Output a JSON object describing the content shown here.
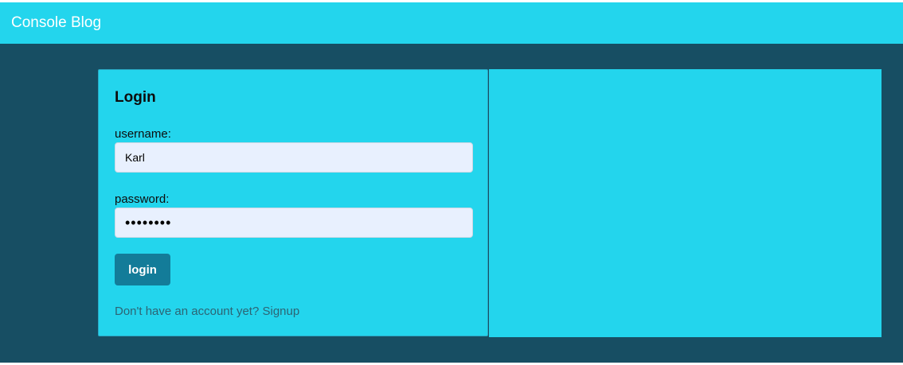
{
  "navbar": {
    "brand": "Console Blog"
  },
  "login_form": {
    "title": "Login",
    "username_label": "username:",
    "username_value": "Karl",
    "password_label": "password:",
    "password_value": "••••••••",
    "login_button_label": "login",
    "signup_prompt": "Don't have an account yet?",
    "signup_link_label": "Signup"
  },
  "colors": {
    "navbar_bg": "#23d5ed",
    "page_bg": "#174e63",
    "panel_bg": "#23d5ed",
    "input_bg": "#e8f0fe",
    "button_bg": "#137c99",
    "link_text": "#2d6474"
  }
}
